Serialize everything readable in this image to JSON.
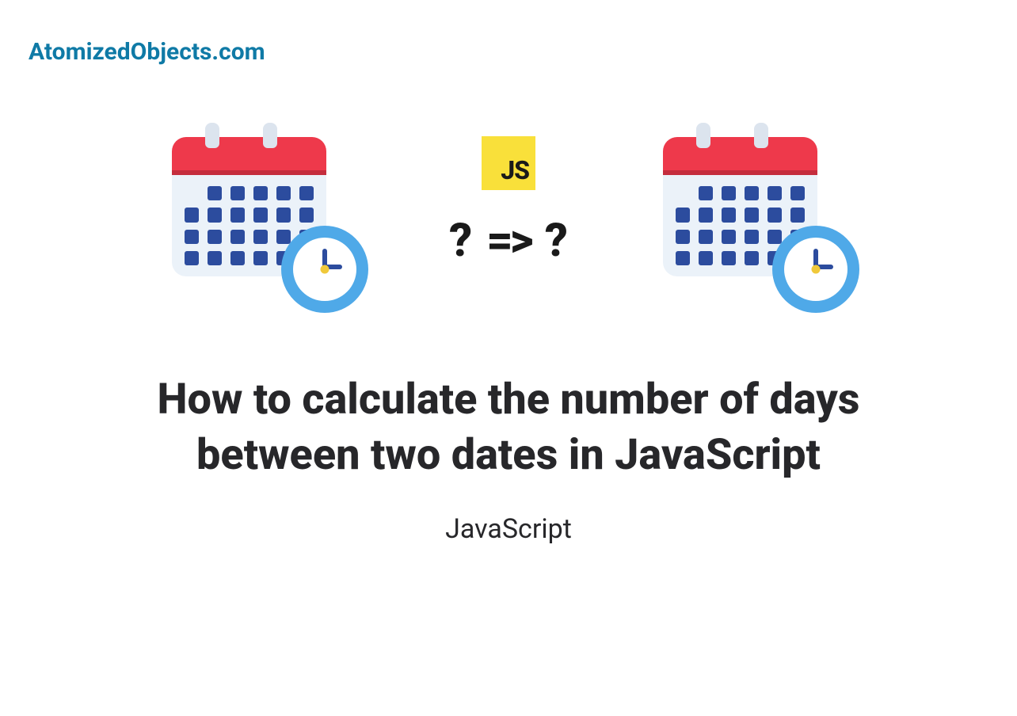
{
  "site_name": "AtomizedObjects.com",
  "js_badge": "JS",
  "middle": {
    "question_left": "?",
    "arrow": "=>",
    "question_right": "?"
  },
  "title": "How to calculate the number of days between two dates in JavaScript",
  "subtitle": "JavaScript"
}
